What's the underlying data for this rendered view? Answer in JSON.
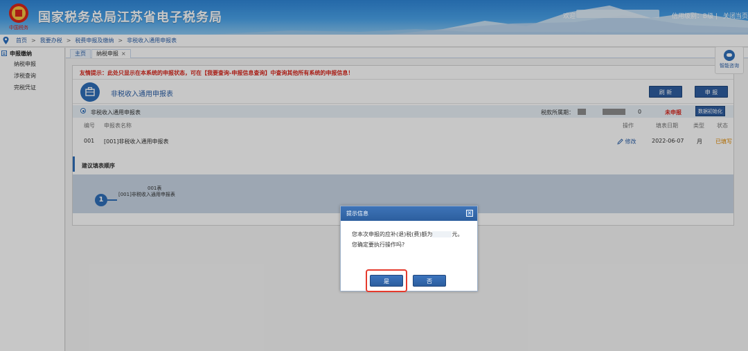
{
  "header": {
    "site_title": "国家税务总局江苏省电子税务局",
    "emblem_text": "中国税务",
    "welcome": "欢迎",
    "credit_level": "信用级别：B级",
    "separator": "|",
    "close_page": "关闭当页"
  },
  "breadcrumb": [
    "首页",
    "我要办税",
    "税费申报及缴纳",
    "非税收入通用申报表"
  ],
  "breadcrumb_sep": ">",
  "sidebar": {
    "group": "申报缴纳",
    "items": [
      "纳税申报",
      "涉税查询",
      "完税凭证"
    ]
  },
  "tabs": {
    "home": "主页",
    "active": "纳税申报",
    "close": "×"
  },
  "panel": {
    "tip": "友情提示：此处只显示在本系统的申报状态，可在【我要查询-申报信息查询】中查询其他所有系统的申报信息！",
    "form_title": "非税收入通用申报表",
    "refresh_label": "刷 新",
    "declare_label": "申 报",
    "row_label": "非税收入通用申报表",
    "period_label": "税款所属期：",
    "period_suffix": "0",
    "status_text": "未申报",
    "init_label": "数据初始化",
    "columns": {
      "num": "编号",
      "name": "申报表名称",
      "op": "操作",
      "date": "填表日期",
      "type": "类型",
      "status": "状态"
    },
    "rows": [
      {
        "num": "001",
        "name": "[001]非税收入通用申报表",
        "edit": "修改",
        "date": "2022-06-07",
        "type": "月",
        "status": "已填写"
      }
    ],
    "order_label": "建议填表顺序",
    "step": {
      "num": "1",
      "code": "001表",
      "name": "[001]非税收入通用申报表"
    }
  },
  "dialog": {
    "title": "提示信息",
    "close": "×",
    "line1_prefix": "您本次申报的应补(退)税(费)额为",
    "line1_suffix": "元。",
    "line2": "您确定要执行操作吗?",
    "yes_label": "是",
    "no_label": "否"
  },
  "helper": {
    "label": "智能咨询"
  },
  "colors": {
    "accent_blue": "#2f6fb9",
    "tip_red": "#d9261c",
    "status_orange": "#e08a00",
    "highlight_red": "#e53a2c"
  }
}
